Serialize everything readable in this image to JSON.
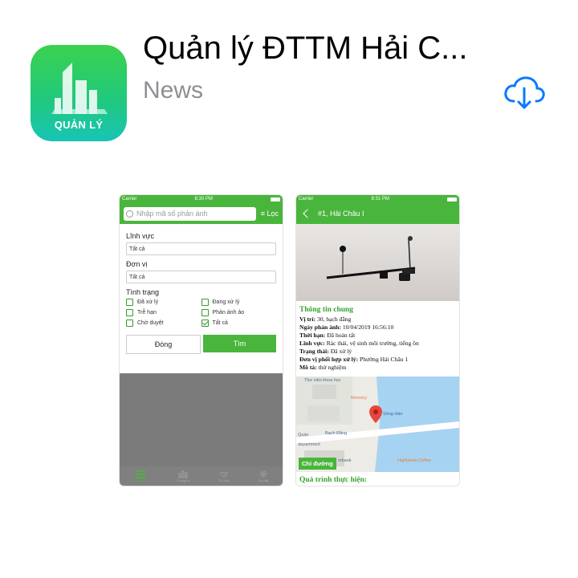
{
  "app": {
    "title": "Quản lý ĐTTM Hải C...",
    "category": "News",
    "icon_label": "QUẢN LÝ",
    "accent": "#49b53c",
    "download_icon": "cloud-download-icon"
  },
  "screen1": {
    "status": {
      "carrier": "Carrier",
      "time": "8:30 PM"
    },
    "search_placeholder": "Nhập mã số phản ánh",
    "filter_label": "Lọc",
    "field_label": "Lĩnh vực",
    "field_value": "Tất cả",
    "unit_label": "Đơn vị",
    "unit_value": "Tất cả",
    "status_label": "Tình trạng",
    "checkboxes": [
      {
        "label": "Đã xử lý",
        "checked": false
      },
      {
        "label": "Đang xử lý",
        "checked": false
      },
      {
        "label": "Trễ hạn",
        "checked": false
      },
      {
        "label": "Phản ánh ảo",
        "checked": false
      },
      {
        "label": "Chờ duyệt",
        "checked": false
      },
      {
        "label": "Tất cả",
        "checked": true
      }
    ],
    "close_button": "Đóng",
    "find_button": "Tìm",
    "tabs": [
      "Phản ánh",
      "Thống kê",
      "Tin nhà",
      "Cài đặt"
    ]
  },
  "screen2": {
    "status": {
      "carrier": "Carrier",
      "time": "8:31 PM"
    },
    "title": "#1, Hải Châu I",
    "section_title": "Thông tin chung",
    "rows": [
      {
        "label": "Vị trí:",
        "value": "30, bạch đằng"
      },
      {
        "label": "Ngày phản ánh:",
        "value": "10/04/2019 16:56:10"
      },
      {
        "label": "Thời hạn:",
        "value": "Đã hoàn tất"
      },
      {
        "label": "Lĩnh vực:",
        "value": "Rác thải, vệ sinh môi trường, tiếng ồn"
      },
      {
        "label": "Trạng thái:",
        "value": "Đã xử lý"
      },
      {
        "label": "Đơn vị phối hợp xử lý:",
        "value": "Phường Hải Châu 1"
      },
      {
        "label": "Mô tả:",
        "value": "thử nghiệm"
      }
    ],
    "map_labels": {
      "memory": "Memory",
      "song_han": "Sông Hàn",
      "street": "Bạch Đằng",
      "dept": "department",
      "bank": "mbank",
      "cafe": "Highlands Coffee",
      "lib": "Thư viện khoa học",
      "quan": "Quán"
    },
    "directions_button": "Chỉ đường",
    "section2_title": "Quá trình thực hiện:"
  }
}
